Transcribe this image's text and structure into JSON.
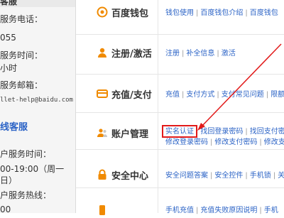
{
  "sidebar": {
    "lines": [
      "客服",
      "服务电话：",
      "055",
      "服务时间：",
      "小时",
      "服务邮箱：",
      "llet-help@baidu.com",
      "线客服",
      "户服务时间：",
      "00-19:00（周一",
      "日）",
      "户服务热线：",
      "00"
    ]
  },
  "categories": [
    {
      "title": "百度钱包",
      "icon": "wallet-icon",
      "links": [
        "钱包使用",
        "百度钱包介绍",
        "百度钱包"
      ]
    },
    {
      "title": "注册/激活",
      "icon": "user-icon",
      "links": [
        "注册",
        "补全信息",
        "激活"
      ]
    },
    {
      "title": "充值/支付",
      "icon": "card-icon",
      "links": [
        "充值",
        "支付方式",
        "支付常见问题",
        "限额"
      ]
    },
    {
      "title": "账户管理",
      "icon": "account-icon",
      "links": [
        "实名认证",
        "找回登录密码",
        "找回支付密"
      ],
      "links2": [
        "修改登录密码",
        "修改支付密码",
        "修改支"
      ]
    },
    {
      "title": "安全中心",
      "icon": "lock-icon",
      "links": [
        "安全问题答案",
        "安全控件",
        "手机锁",
        "关"
      ]
    },
    {
      "title": "",
      "icon": "",
      "links": [
        "手机充值",
        "充值失败原因说明",
        "手机"
      ]
    }
  ],
  "colors": {
    "link": "#2b63c6",
    "accent": "#f08a00",
    "highlight": "#e21a1a"
  }
}
